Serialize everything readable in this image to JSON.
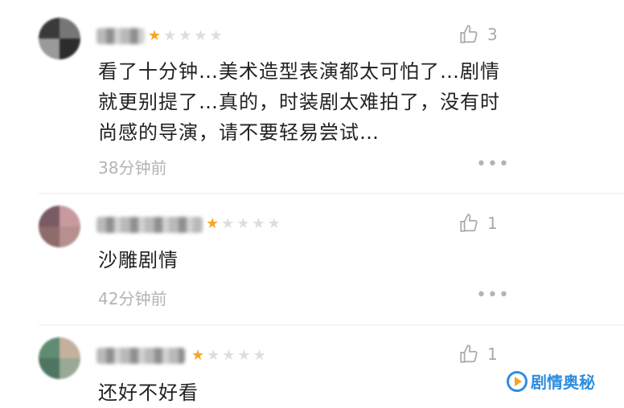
{
  "comments": [
    {
      "rating": 1,
      "likes": "3",
      "text": "看了十分钟…美术造型表演都太可怕了…剧情就更别提了…真的，时装剧太难拍了，没有时尚感的导演，请不要轻易尝试…",
      "time": "38分钟前",
      "more": "•••",
      "avatar_colors": [
        "#3a3a3a",
        "#777777",
        "#9a9a9a",
        "#2c2c2c"
      ]
    },
    {
      "rating": 1,
      "likes": "1",
      "text": "沙雕剧情",
      "time": "42分钟前",
      "more": "•••",
      "avatar_colors": [
        "#7a5a63",
        "#c89a9f",
        "#8e6c6c",
        "#b78f8f"
      ]
    },
    {
      "rating": 1,
      "likes": "1",
      "text": "还好不好看",
      "time": "",
      "more": "",
      "avatar_colors": [
        "#5f8c72",
        "#c3b19e",
        "#4f7562",
        "#9aa995"
      ]
    }
  ],
  "watermark": {
    "text": "剧情奥秘",
    "logo_icon": "play-circle-icon"
  },
  "colors": {
    "star_on": "#f5a623",
    "star_off": "#dddddd",
    "muted": "#b3b3b3",
    "brand": "#2f8de0"
  }
}
